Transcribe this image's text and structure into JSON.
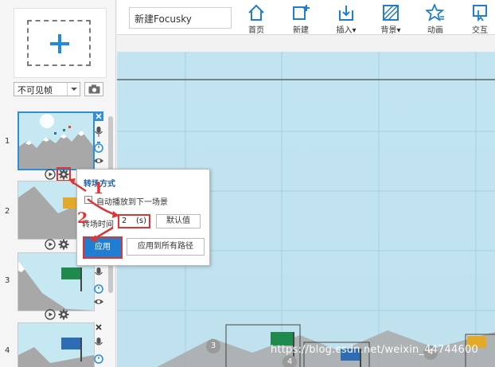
{
  "project_name": "新建Focusky",
  "toolbar": [
    {
      "label": "首页",
      "icon": "home-icon"
    },
    {
      "label": "新建",
      "icon": "new-frame-icon"
    },
    {
      "label": "插入",
      "icon": "insert-icon"
    },
    {
      "label": "背景",
      "icon": "background-icon"
    },
    {
      "label": "动画",
      "icon": "animation-star-icon"
    },
    {
      "label": "交互",
      "icon": "interaction-icon"
    }
  ],
  "left": {
    "visibility_select": "不可见帧",
    "frames": [
      {
        "num": "1",
        "selected": true
      },
      {
        "num": "2",
        "selected": false
      },
      {
        "num": "3",
        "selected": false
      },
      {
        "num": "4",
        "selected": false
      }
    ]
  },
  "popup": {
    "title": "转场方式",
    "auto_play_label": "自动播放到下一场景",
    "auto_play_checked": false,
    "time_label": "转场时间",
    "time_value": "2",
    "time_unit": "(s)",
    "default_label": "默认值",
    "apply_label": "应用",
    "apply_all_label": "应用到所有路径"
  },
  "annotations": {
    "step1": "1",
    "step2": "2"
  },
  "canvas": {
    "path_numbers": [
      "3",
      "4",
      "4"
    ]
  },
  "watermark": "https://blog.csdn.net/weixin_44744600",
  "colors": {
    "accent": "#1f7ed0",
    "annotation": "#e03434",
    "canvas_bg": "#c9e6f1",
    "popup_title": "#1e5fa8"
  }
}
